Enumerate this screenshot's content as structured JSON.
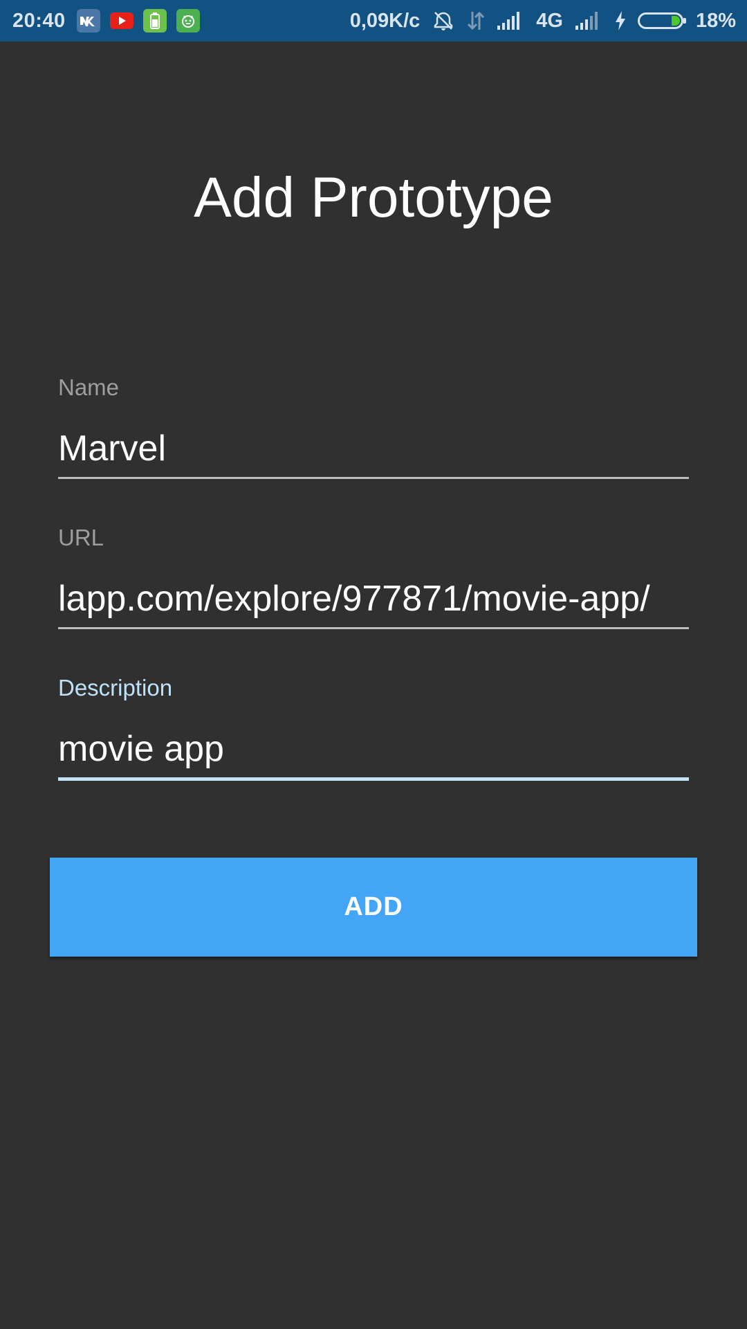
{
  "status_bar": {
    "time": "20:40",
    "network_speed": "0,09K/c",
    "network_type": "4G",
    "battery_percent": "18%",
    "battery_level": 0.18,
    "notification_icons": [
      "vk-icon",
      "youtube-icon",
      "battery-app-icon",
      "android-bot-icon"
    ],
    "colors": {
      "background": "#115283",
      "battery_fill": "#4fc72c"
    }
  },
  "page": {
    "title": "Add Prototype",
    "background": "#303030"
  },
  "form": {
    "name": {
      "label": "Name",
      "value": "Marvel"
    },
    "url": {
      "label": "URL",
      "value": "lapp.com/explore/977871/movie-app/"
    },
    "description": {
      "label": "Description",
      "value": "movie app",
      "focused": true
    }
  },
  "actions": {
    "add_label": "ADD",
    "add_color": "#42a5f5"
  }
}
